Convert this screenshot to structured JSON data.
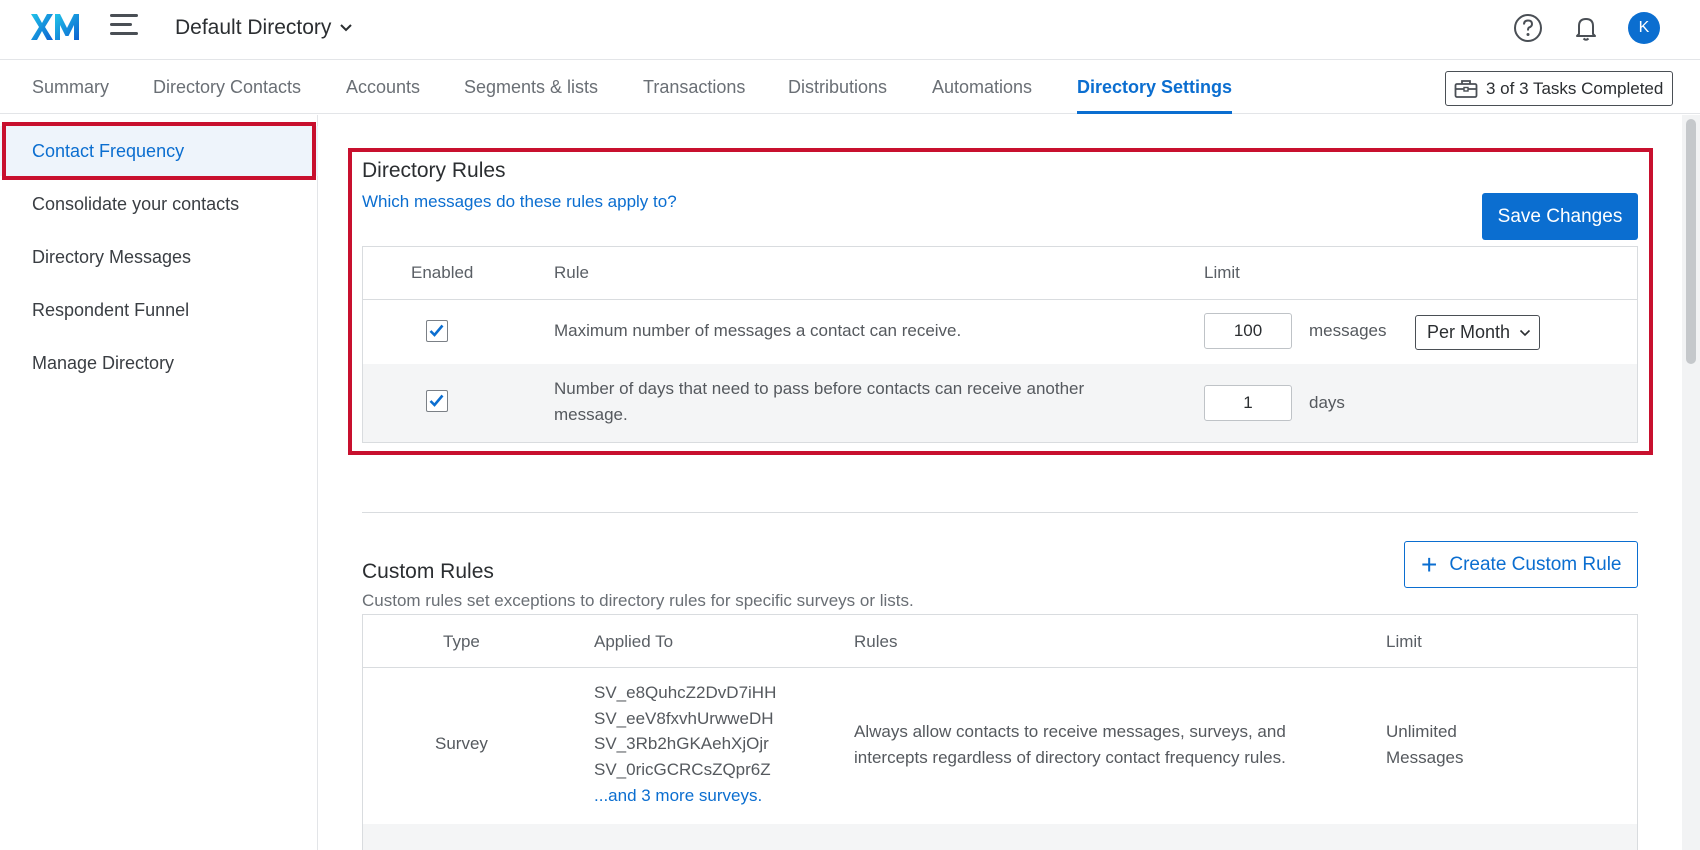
{
  "header": {
    "logo_text": "XM",
    "directory_label": "Default Directory",
    "avatar_initial": "K"
  },
  "nav": {
    "tabs": [
      {
        "label": "Summary"
      },
      {
        "label": "Directory Contacts"
      },
      {
        "label": "Accounts"
      },
      {
        "label": "Segments & lists"
      },
      {
        "label": "Transactions"
      },
      {
        "label": "Distributions"
      },
      {
        "label": "Automations"
      },
      {
        "label": "Directory Settings",
        "active": true
      }
    ],
    "tasks_label": "3 of 3 Tasks Completed"
  },
  "sidebar": {
    "items": [
      {
        "label": "Contact Frequency",
        "active": true
      },
      {
        "label": "Consolidate your contacts"
      },
      {
        "label": "Directory Messages"
      },
      {
        "label": "Respondent Funnel"
      },
      {
        "label": "Manage Directory"
      }
    ]
  },
  "directory_rules": {
    "title": "Directory Rules",
    "help_link": "Which messages do these rules apply to?",
    "save_label": "Save Changes",
    "columns": [
      "Enabled",
      "Rule",
      "Limit"
    ],
    "rows": [
      {
        "enabled": true,
        "rule": "Maximum number of messages a contact can receive.",
        "limit_value": "100",
        "unit": "messages",
        "period": "Per Month"
      },
      {
        "enabled": true,
        "rule_line1": "Number of days that need to pass before contacts can receive another",
        "rule_line2": "message.",
        "limit_value": "1",
        "unit": "days"
      }
    ]
  },
  "custom_rules": {
    "title": "Custom Rules",
    "subtitle": "Custom rules set exceptions to directory rules for specific surveys or lists.",
    "create_label": "Create Custom Rule",
    "columns": [
      "Type",
      "Applied To",
      "Rules",
      "Limit"
    ],
    "rows": [
      {
        "type": "Survey",
        "applied_to": [
          "SV_e8QuhcZ2DvD7iHH",
          "SV_eeV8fxvhUrwweDH",
          "SV_3Rb2hGKAehXjOjr",
          "SV_0ricGCRCsZQpr6Z"
        ],
        "more_link": "...and 3 more surveys.",
        "rules_line1": "Always allow contacts to receive messages, surveys, and",
        "rules_line2": "intercepts regardless of directory contact frequency rules.",
        "limit_line1": "Unlimited",
        "limit_line2": "Messages"
      }
    ]
  },
  "colors": {
    "accent": "#0b6ed0",
    "highlight": "#c8102e"
  },
  "icons": [
    "xm-logo",
    "hamburger-icon",
    "chevron-down-icon",
    "help-icon",
    "bell-icon",
    "briefcase-icon",
    "checkmark-icon",
    "plus-icon"
  ]
}
